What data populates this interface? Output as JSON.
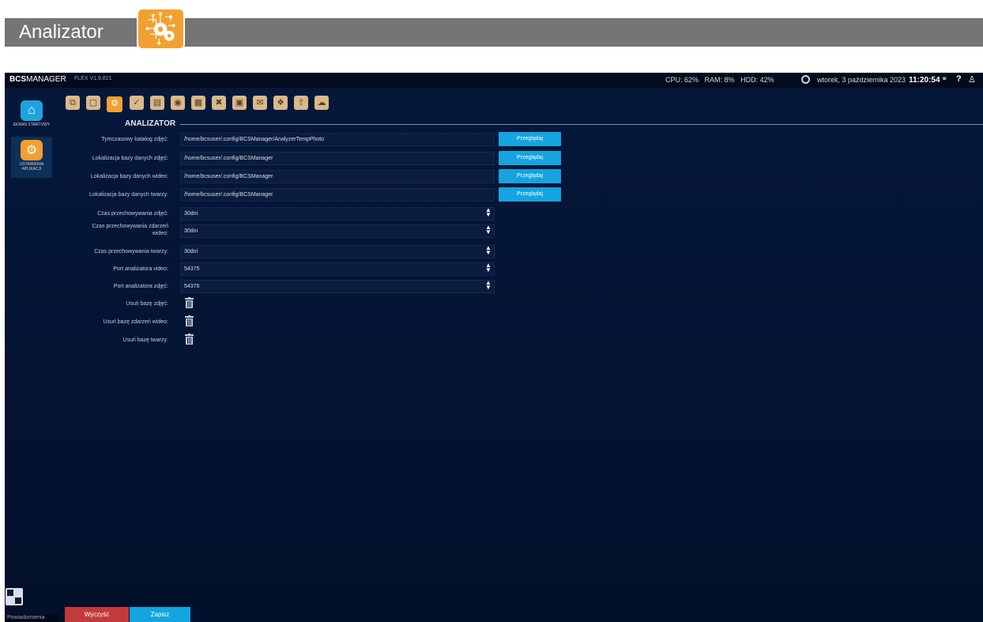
{
  "banner": {
    "title": "Analizator",
    "icon": "analyzer-gear-icon",
    "accent": "#f2a031"
  },
  "topbar": {
    "brand_bold": "BCS",
    "brand_rest": "MANAGER",
    "version": "FLEX V1.9.821",
    "cpu": "CPU: 62%",
    "ram": "RAM: 8%",
    "hdd": "HDD: 42%",
    "date": "wtorek, 3 października 2023",
    "time": "11:20:54",
    "help": "?"
  },
  "sidebar": {
    "items": [
      {
        "label": "EKRAN STARTOWY",
        "icon": "home-icon",
        "color": "#1fa3df"
      },
      {
        "label": "USTAWIENIA APLIKACJI",
        "icon": "gears-icon",
        "color": "#f2a031"
      }
    ]
  },
  "toolbar": {
    "icons": [
      "windows-icon",
      "film-icon",
      "analyzer-icon",
      "camera-icon",
      "recorder-icon",
      "cam-settings-icon",
      "car-icon",
      "tools-icon",
      "export-icon",
      "mail-icon",
      "network-icon",
      "upload-icon",
      "cloud-icon"
    ]
  },
  "section": {
    "title": "ANALIZATOR"
  },
  "form": {
    "paths": [
      {
        "label": "Tymczasowy katalog zdjęć:",
        "value": "/home/bcsuser/.config/BCSManager/AnalyzerTempPhoto",
        "button": "Przeglądaj"
      },
      {
        "label": "Lokalizacja bazy danych zdjęć:",
        "value": "/home/bcsuser/.config/BCSManager",
        "button": "Przeglądaj"
      },
      {
        "label": "Lokalizacja bazy danych wideo:",
        "value": "/home/bcsuser/.config/BCSManager",
        "button": "Przeglądaj"
      },
      {
        "label": "Lokalizacja bazy danych twarzy:",
        "value": "/home/bcsuser/.config/BCSManager",
        "button": "Przeglądaj"
      }
    ],
    "spins": [
      {
        "label": "Czas przechowywania zdjęć:",
        "value": "30dni"
      },
      {
        "label_line1": "Czas przechowywania zdarzeń",
        "label_line2": "wideo:",
        "value": "30dni"
      },
      {
        "label": "Czas przechowywania twarzy:",
        "value": "30dni"
      },
      {
        "label": "Port analizatora video:",
        "value": "54375"
      },
      {
        "label": "Port analizatora zdjęć:",
        "value": "54376"
      }
    ],
    "deletes": [
      {
        "label": "Usuń bazę zdjęć:"
      },
      {
        "label": "Usuń bazę zdarzeń wideo:"
      },
      {
        "label": "Usuń bazę twarzy:"
      }
    ]
  },
  "bottom": {
    "left_text": "Powiadomienia",
    "clear": "Wyczyść",
    "save": "Zapisz",
    "clear_color": "#c23a3a",
    "save_color": "#14a4e0"
  }
}
